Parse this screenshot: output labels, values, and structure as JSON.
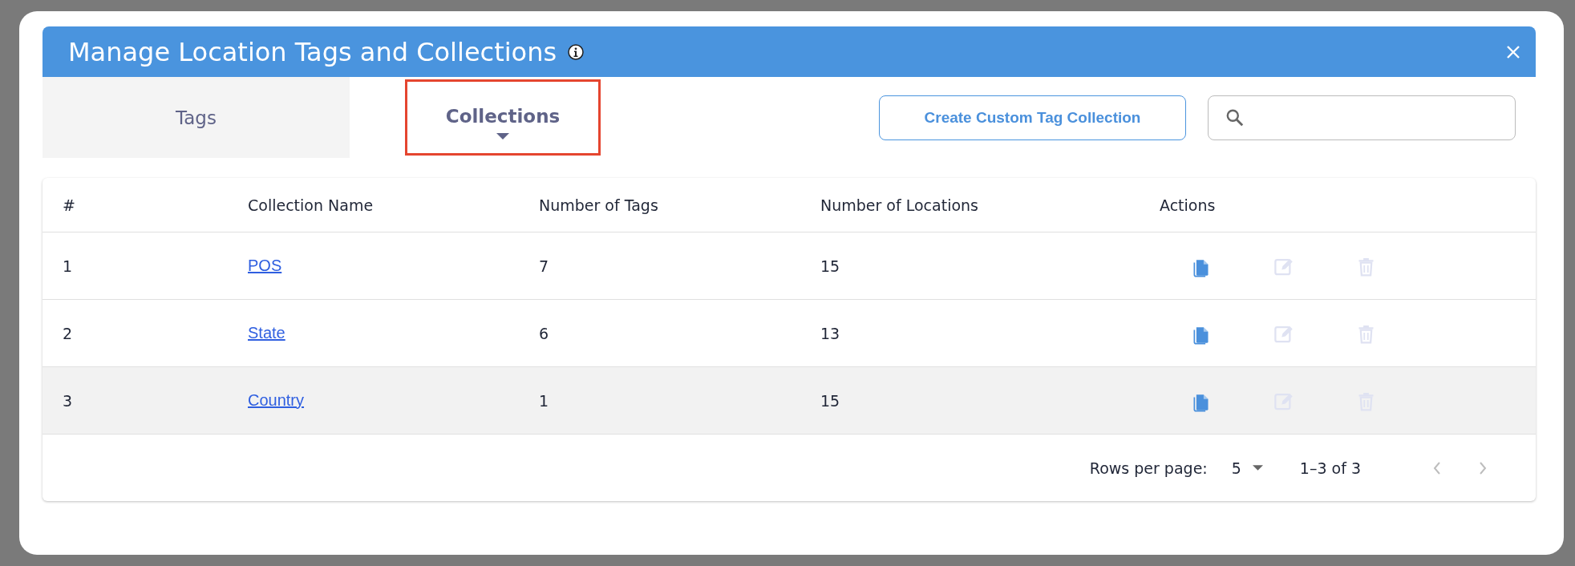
{
  "dialog": {
    "title": "Manage Location Tags and Collections"
  },
  "tabs": [
    {
      "label": "Tags",
      "selected": false
    },
    {
      "label": "Collections",
      "selected": true
    }
  ],
  "create_button": {
    "label": "Create Custom Tag Collection"
  },
  "table": {
    "columns": [
      "#",
      "Collection Name",
      "Number of Tags",
      "Number of Locations",
      "Actions"
    ],
    "rows": [
      {
        "index": "1",
        "name": "POS",
        "tags": "7",
        "locations": "15",
        "highlighted": false,
        "actions": [
          {
            "kind": "copy",
            "disabled": false
          },
          {
            "kind": "edit",
            "disabled": true
          },
          {
            "kind": "delete",
            "disabled": true
          }
        ]
      },
      {
        "index": "2",
        "name": "State",
        "tags": "6",
        "locations": "13",
        "highlighted": false,
        "actions": [
          {
            "kind": "copy",
            "disabled": false
          },
          {
            "kind": "edit",
            "disabled": true
          },
          {
            "kind": "delete",
            "disabled": true
          }
        ]
      },
      {
        "index": "3",
        "name": "Country",
        "tags": "1",
        "locations": "15",
        "highlighted": true,
        "actions": [
          {
            "kind": "copy",
            "disabled": false
          },
          {
            "kind": "edit",
            "disabled": true
          },
          {
            "kind": "delete",
            "disabled": true
          }
        ]
      }
    ]
  },
  "pagination": {
    "rows_per_page_label": "Rows per page:",
    "rows_per_page": "5",
    "range": "1–3 of 3",
    "previous_disabled": true,
    "next_disabled": true
  }
}
